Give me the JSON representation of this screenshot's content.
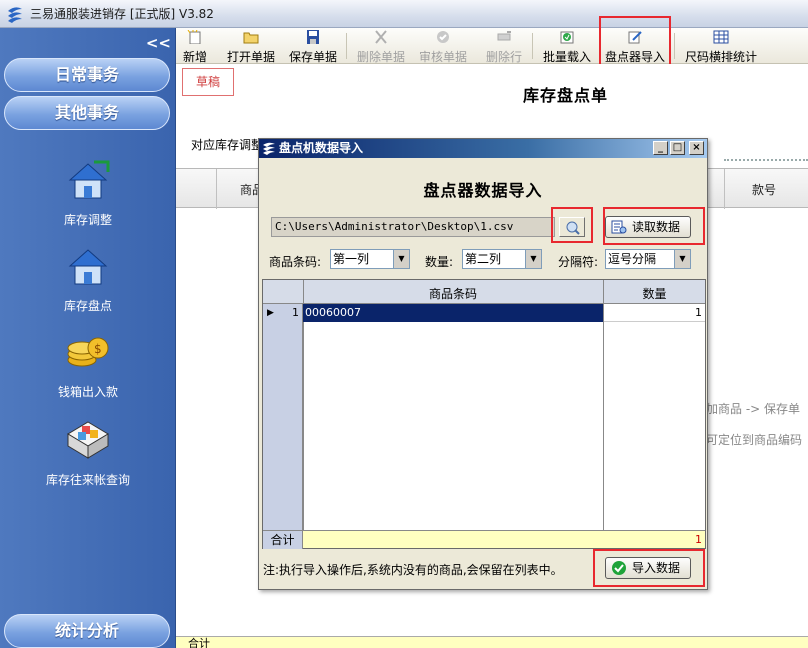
{
  "window": {
    "title": "三易通服装进销存 [正式版] V3.82"
  },
  "sidebar": {
    "collapse_glyph": "<<",
    "sections": [
      "日常事务",
      "其他事务"
    ],
    "items": [
      {
        "label": "库存调整",
        "icon": "house-arrow-icon"
      },
      {
        "label": "库存盘点",
        "icon": "house-icon"
      },
      {
        "label": "钱箱出入款",
        "icon": "coins-icon"
      },
      {
        "label": "库存往来帐查询",
        "icon": "boxes-icon"
      }
    ],
    "bottom_section": "统计分析"
  },
  "toolbar": {
    "buttons": [
      {
        "label": "新增",
        "enabled": true
      },
      {
        "label": "打开单据",
        "enabled": true
      },
      {
        "label": "保存单据",
        "enabled": true
      },
      {
        "label": "删除单据",
        "enabled": false
      },
      {
        "label": "审核单据",
        "enabled": false
      },
      {
        "label": "删除行",
        "enabled": false
      },
      {
        "label": "批量载入",
        "enabled": true
      },
      {
        "label": "盘点器导入",
        "enabled": true
      },
      {
        "label": "尺码横排统计",
        "enabled": true
      }
    ]
  },
  "document": {
    "status_badge": "草稿",
    "title": "库存盘点单",
    "adjust_label": "对应库存调整",
    "columns": [
      "商品",
      "款号"
    ],
    "hints": [
      "加商品 -> 保存单",
      "可定位到商品编码"
    ],
    "footer_label": "合计"
  },
  "dialog": {
    "title": "盘点机数据导入",
    "heading": "盘点器数据导入",
    "file_path": "C:\\Users\\Administrator\\Desktop\\1.csv",
    "read_button": "读取数据",
    "barcode_label": "商品条码:",
    "barcode_column": "第一列",
    "qty_label": "数量:",
    "qty_column": "第二列",
    "separator_label": "分隔符:",
    "separator_value": "逗号分隔",
    "table": {
      "headers": [
        "商品条码",
        "数量"
      ],
      "rows": [
        {
          "index": "1",
          "barcode": "00060007",
          "qty": "1"
        }
      ],
      "total_label": "合计",
      "total_qty": "1"
    },
    "note": "注:执行导入操作后,系统内没有的商品,会保留在列表中。",
    "import_button": "导入数据"
  },
  "colors": {
    "highlight": "#e8282f",
    "sidebar": "#3a64ae",
    "selection": "#0a246a"
  }
}
